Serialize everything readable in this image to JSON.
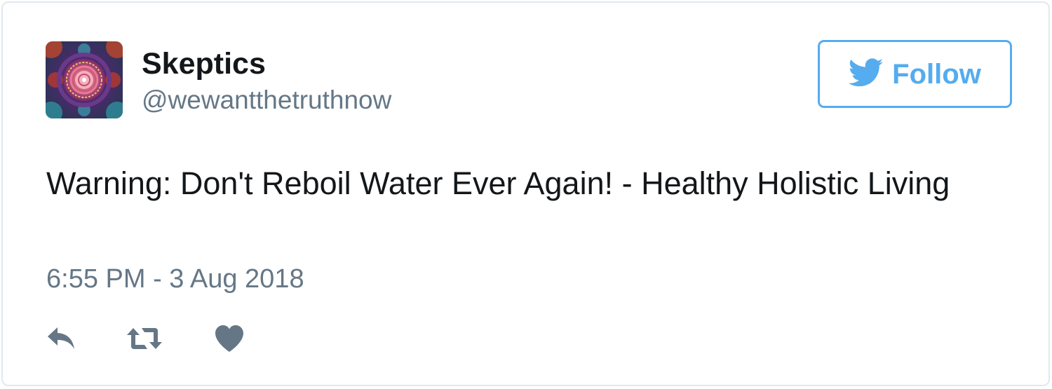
{
  "author": {
    "display_name": "Skeptics",
    "handle": "@wewantthetruthnow",
    "avatar_icon": "mandala-avatar"
  },
  "follow_button": {
    "label": "Follow",
    "icon": "twitter-bird-icon",
    "color": "#55acee"
  },
  "tweet": {
    "text": "Warning: Don't Reboil Water Ever Again! - Healthy Holistic Living",
    "timestamp": "6:55 PM - 3 Aug 2018"
  },
  "actions": [
    {
      "name": "reply",
      "icon": "reply-icon"
    },
    {
      "name": "retweet",
      "icon": "retweet-icon"
    },
    {
      "name": "like",
      "icon": "heart-icon"
    }
  ],
  "colors": {
    "text": "#14171a",
    "secondary_text": "#657786",
    "border": "#e1e8ed",
    "accent": "#55acee"
  }
}
